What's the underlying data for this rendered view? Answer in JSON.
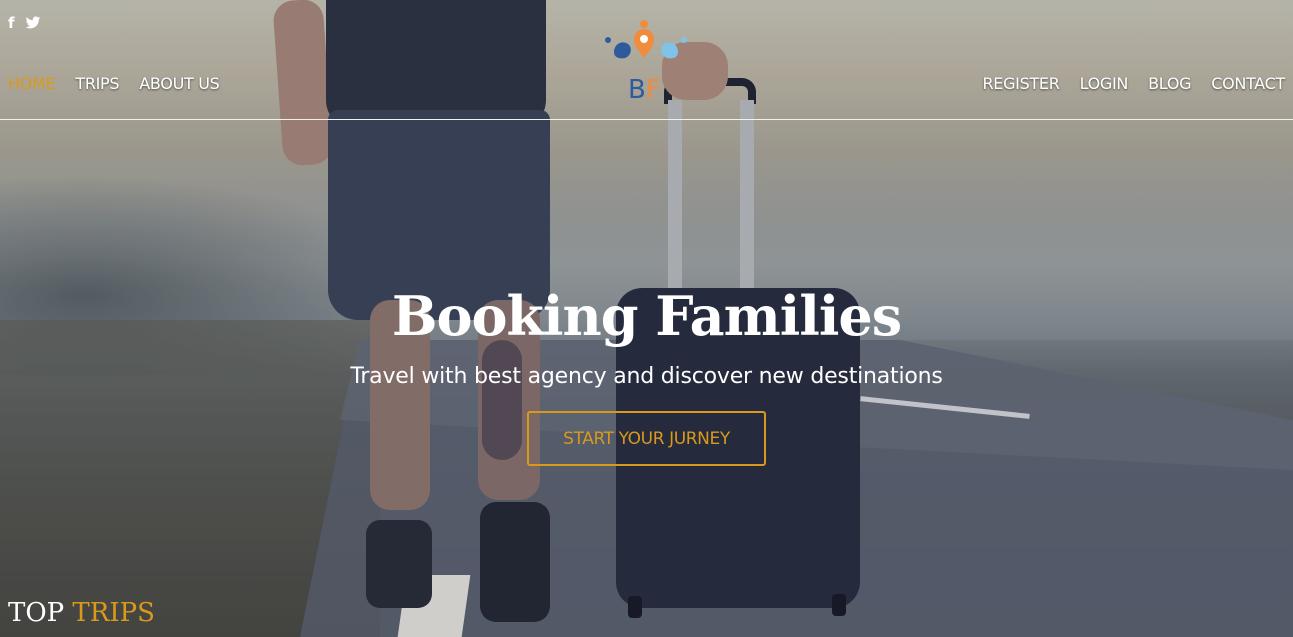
{
  "social": {
    "facebook_icon": "facebook-icon",
    "twitter_icon": "twitter-icon"
  },
  "nav": {
    "left": [
      {
        "label": "HOME",
        "active": true
      },
      {
        "label": "TRIPS",
        "active": false
      },
      {
        "label": "ABOUT US",
        "active": false
      }
    ],
    "right": [
      {
        "label": "REGISTER"
      },
      {
        "label": "LOGIN"
      },
      {
        "label": "BLOG"
      },
      {
        "label": "CONTACT"
      }
    ]
  },
  "logo": {
    "text": "BF",
    "icon": "map-pin-people-logo"
  },
  "hero": {
    "title": "Booking Families",
    "subtitle": "Travel with best agency and discover new destinations",
    "cta_label": "START YOUR JURNEY"
  },
  "section": {
    "title_part1": "TOP",
    "title_part2": "TRIPS"
  },
  "colors": {
    "accent": "#d99a1c",
    "text_light": "#ffffff"
  }
}
